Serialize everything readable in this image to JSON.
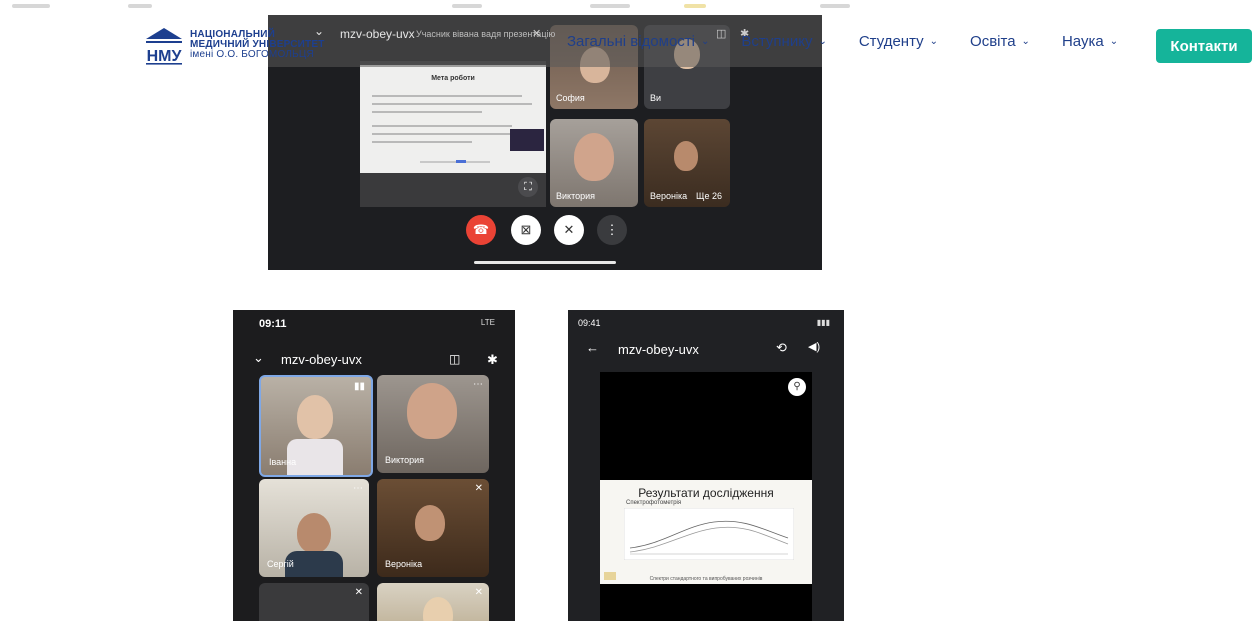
{
  "site": {
    "logo": {
      "letters": "НМУ",
      "line1": "НАЦІОНАЛЬНИЙ",
      "line2": "МЕДИЧНИЙ УНІВЕРСИТЕТ",
      "line3": "імені О.О. БОГОМОЛЬЦЯ"
    },
    "nav": [
      {
        "label": "Загальні відомості"
      },
      {
        "label": "Вступнику"
      },
      {
        "label": "Студенту"
      },
      {
        "label": "Освіта"
      },
      {
        "label": "Наука"
      }
    ],
    "contacts_button": "Контакти",
    "colors": {
      "brand_blue": "#1f3f8a",
      "accent_green": "#15b49a"
    }
  },
  "meeting_main": {
    "code": "mzv-obey-uvx",
    "subtitle": "Учасник вiвана вадя презентацію",
    "slide_title": "Мета роботи",
    "participants": [
      {
        "name": "София"
      },
      {
        "name": "Ви"
      },
      {
        "name": "Виктория"
      },
      {
        "name": "Вероніка"
      },
      {
        "name": "Ще 26"
      }
    ]
  },
  "phone_left": {
    "time": "09:11",
    "status": "LTE",
    "code": "mzv-obey-uvx",
    "participants": [
      {
        "name": "Іванна"
      },
      {
        "name": "Виктория"
      },
      {
        "name": "Сергій"
      },
      {
        "name": "Вероніка"
      }
    ]
  },
  "phone_right": {
    "time": "09:41",
    "code": "mzv-obey-uvx",
    "slide_title": "Результати дослідження",
    "slide_subtitle": "Спектрофотометрія",
    "slide_footer": "Спектри стандартного та випробуваних розчинів"
  }
}
